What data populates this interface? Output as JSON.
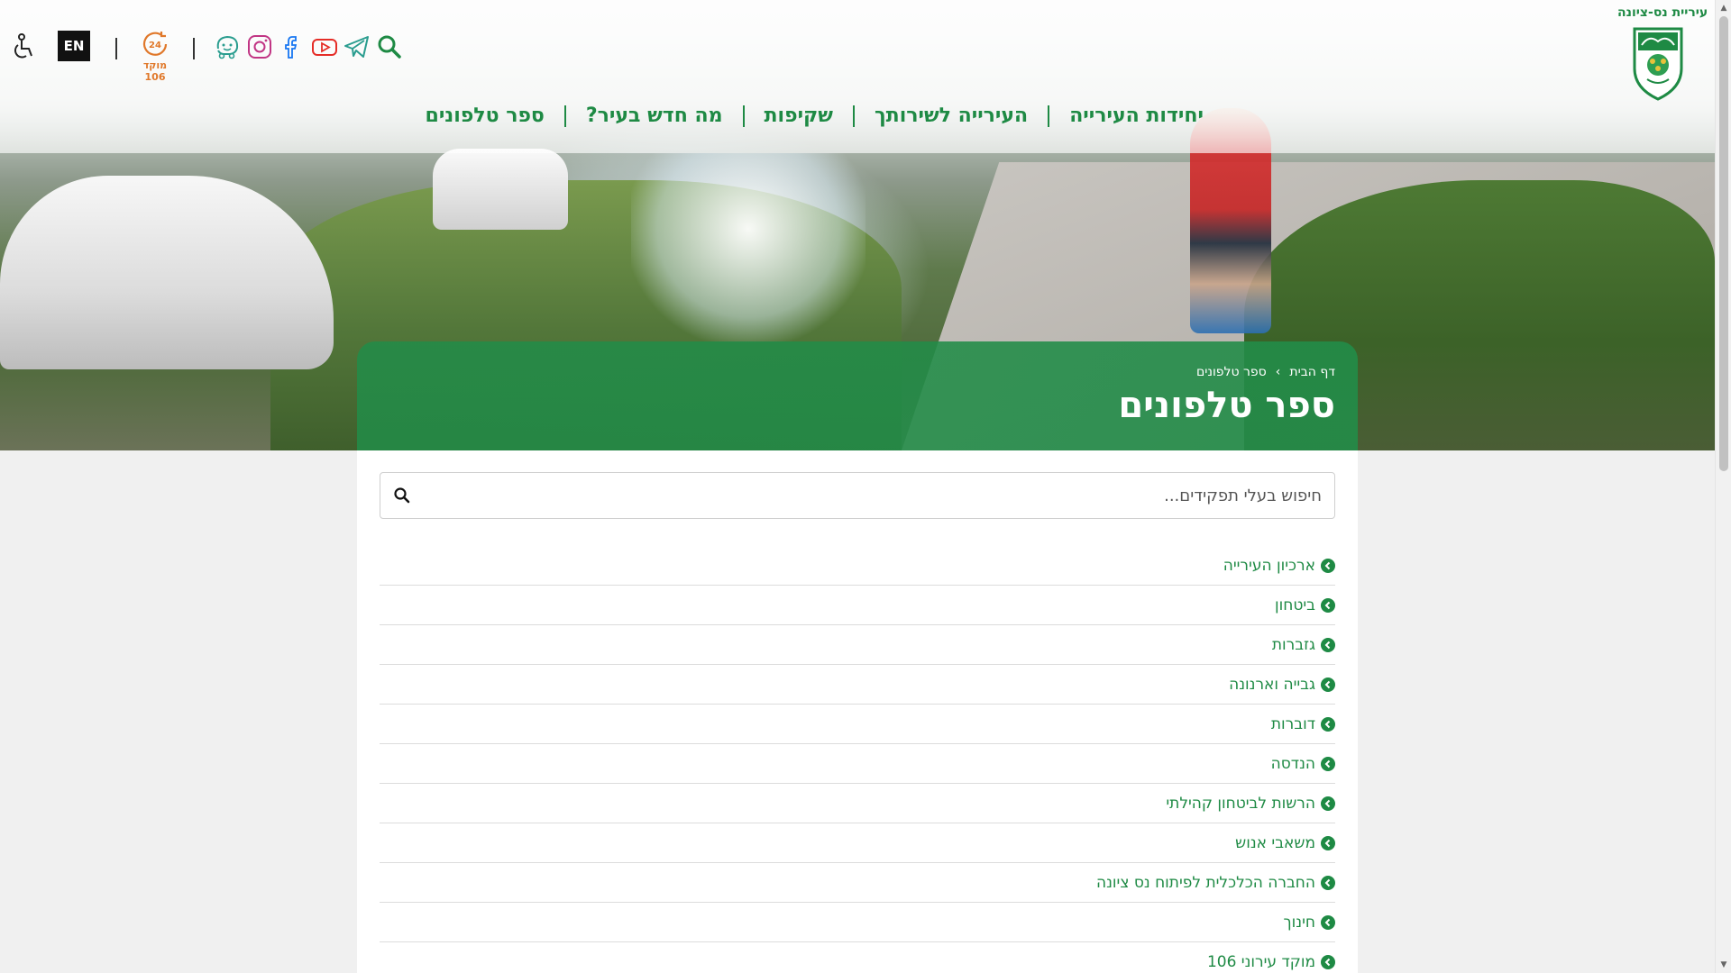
{
  "header": {
    "brand_name": "עיריית נס-ציונה",
    "nav": [
      {
        "label": "יחידות העירייה"
      },
      {
        "label": "העירייה לשירותך"
      },
      {
        "label": "שקיפות"
      },
      {
        "label": "מה חדש בעיר?"
      },
      {
        "label": "ספר טלפונים"
      }
    ],
    "language_button": "EN",
    "hotline_label": "מוקד 106",
    "hotline_badge": "24",
    "icons": [
      "accessibility-icon",
      "hotline-24-icon",
      "waze-icon",
      "instagram-icon",
      "facebook-icon",
      "youtube-icon",
      "telegram-icon",
      "search-icon"
    ]
  },
  "title_box": {
    "breadcrumb": {
      "home": "דף הבית",
      "separator": "›",
      "current": "ספר טלפונים"
    },
    "page_title": "ספר טלפונים"
  },
  "search": {
    "placeholder": "חיפוש בעלי תפקידים..."
  },
  "departments": [
    {
      "label": "ארכיון העירייה"
    },
    {
      "label": "ביטחון"
    },
    {
      "label": "גזברות"
    },
    {
      "label": "גבייה וארנונה"
    },
    {
      "label": "דוברות"
    },
    {
      "label": "הנדסה"
    },
    {
      "label": "הרשות לביטחון קהילתי"
    },
    {
      "label": "משאבי אנוש"
    },
    {
      "label": "החברה הכלכלית לפיתוח נס ציונה"
    },
    {
      "label": "חינוך"
    },
    {
      "label": "מוקד עירוני 106"
    }
  ],
  "colors": {
    "brand_green": "#1e8a44",
    "hotline_orange": "#e0782a",
    "instagram": "#c13584",
    "youtube": "#e52d27",
    "telegram": "#2a9d8f",
    "facebook": "#1877f2"
  }
}
